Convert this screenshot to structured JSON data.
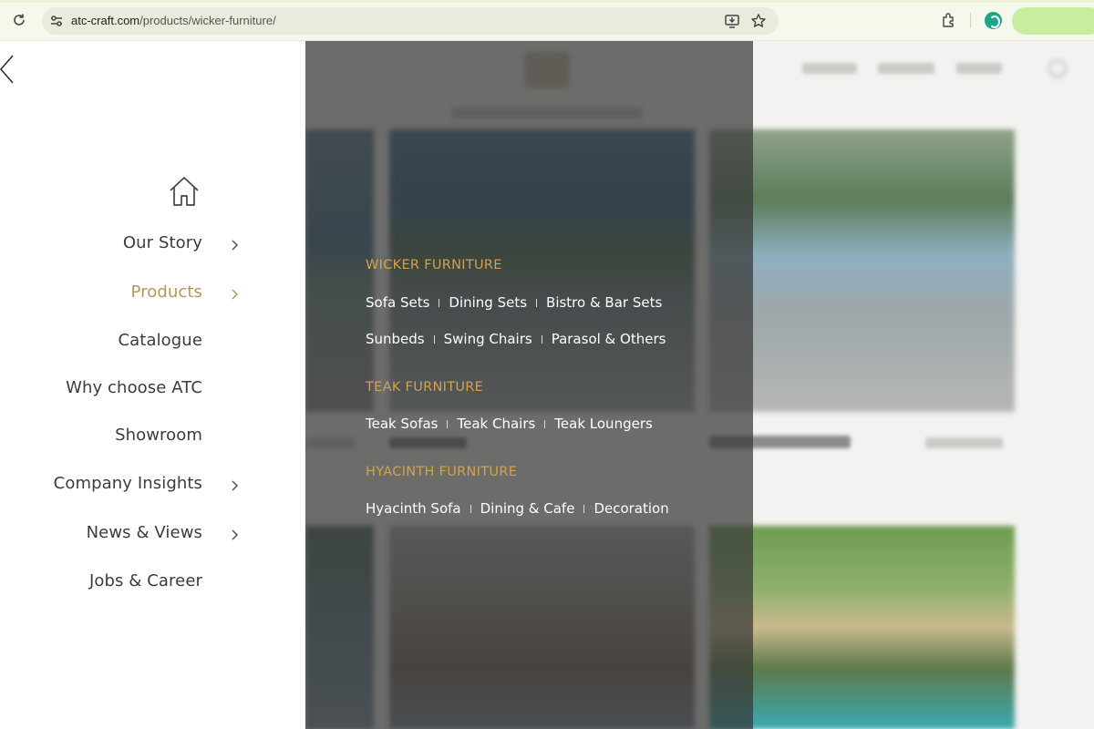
{
  "browser": {
    "url_host": "atc-craft.com",
    "url_path": "/products/wicker-furniture/",
    "icons": [
      "reload-icon",
      "site-info-icon",
      "install-icon",
      "star-icon",
      "extensions-icon",
      "grammarly-icon"
    ]
  },
  "menu": {
    "items": [
      {
        "label": "Our Story",
        "has_submenu": true
      },
      {
        "label": "Products",
        "has_submenu": true,
        "active": true
      },
      {
        "label": "Catalogue",
        "has_submenu": false
      },
      {
        "label": "Why choose ATC",
        "has_submenu": false
      },
      {
        "label": "Showroom",
        "has_submenu": false
      },
      {
        "label": "Company Insights",
        "has_submenu": true
      },
      {
        "label": "News & Views",
        "has_submenu": true
      },
      {
        "label": "Jobs & Career",
        "has_submenu": false
      }
    ],
    "active_color": "#b3985a"
  },
  "dropdown": {
    "categories": [
      {
        "title": "WICKER FURNITURE",
        "rows": [
          [
            "Sofa Sets",
            "Dining Sets",
            "Bistro & Bar Sets"
          ],
          [
            "Sunbeds",
            "Swing Chairs",
            "Parasol & Others"
          ]
        ]
      },
      {
        "title": "TEAK FURNITURE",
        "rows": [
          [
            "Teak Sofas",
            "Teak Chairs",
            "Teak Loungers"
          ]
        ]
      },
      {
        "title": "HYACINTH FURNITURE",
        "rows": [
          [
            "Hyacinth Sofa",
            "Dining & Cafe",
            "Decoration"
          ]
        ]
      }
    ],
    "title_color": "#d2a24e"
  }
}
